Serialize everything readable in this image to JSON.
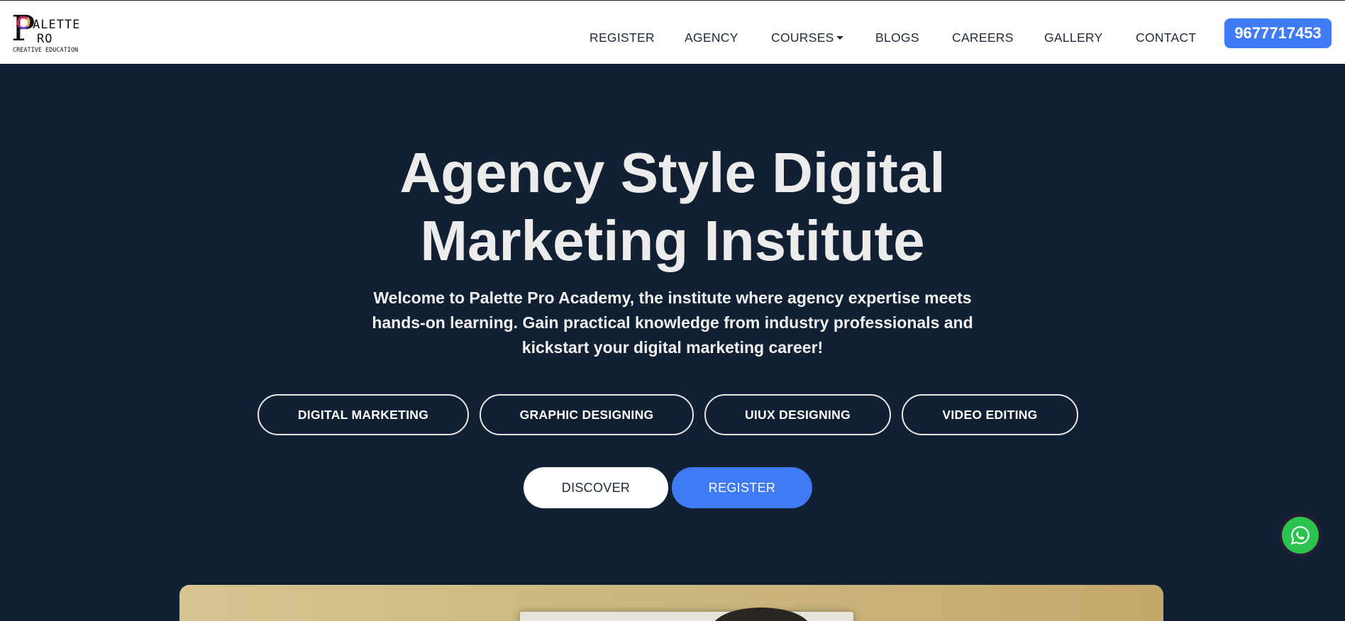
{
  "logo": {
    "p": "P",
    "alette": "ALETTE",
    "ro": "RO",
    "sub": "CREATIVE EDUCATION"
  },
  "nav": {
    "items": [
      {
        "label": "REGISTER"
      },
      {
        "label": "AGENCY"
      },
      {
        "label": "COURSES"
      },
      {
        "label": "BLOGS"
      },
      {
        "label": "CAREERS"
      },
      {
        "label": "GALLERY"
      },
      {
        "label": "CONTACT"
      }
    ],
    "phone": "9677717453"
  },
  "hero": {
    "title_line1": "Agency Style Digital",
    "title_line2": "Marketing Institute",
    "desc_line1": "Welcome to Palette Pro Academy, the institute where agency expertise meets",
    "desc_line2": "hands-on learning. Gain practical knowledge from industry professionals and",
    "desc_line3": "kickstart your digital marketing career!",
    "courses": [
      {
        "label": "DIGITAL MARKETING"
      },
      {
        "label": "GRAPHIC DESIGNING"
      },
      {
        "label": "UIUX DESIGNING"
      },
      {
        "label": "VIDEO EDITING"
      }
    ],
    "discover_label": "DISCOVER",
    "register_label": "REGISTER"
  },
  "colors": {
    "hero_bg": "#122033",
    "accent": "#3f7bf5",
    "whatsapp": "#2bc34f"
  },
  "icons": {
    "whatsapp": "whatsapp-icon",
    "courses_dropdown": "chevron-down-icon"
  }
}
